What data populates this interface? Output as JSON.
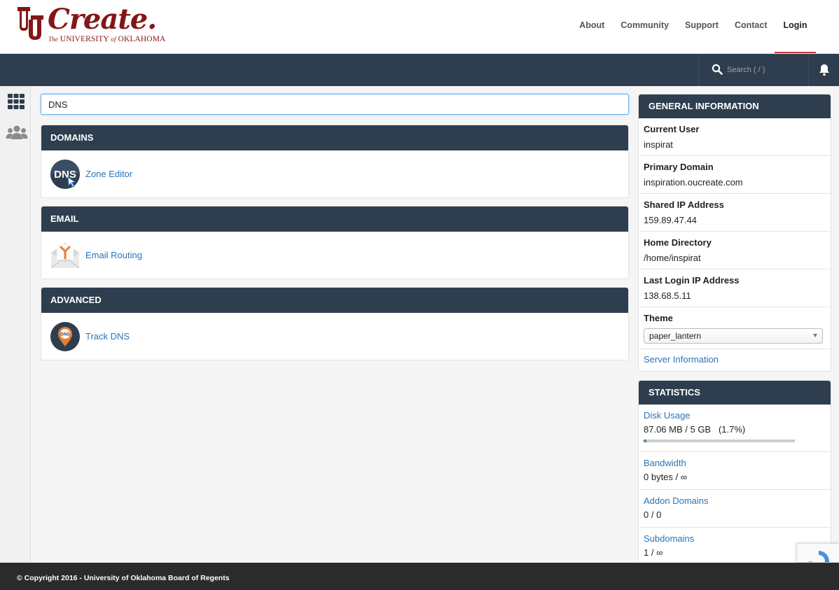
{
  "brand": {
    "logo_word": "Create.",
    "logo_sub_prefix": "The",
    "logo_sub_main": "UNIVERSITY",
    "logo_sub_of": "of",
    "logo_sub_end": "OKLAHOMA"
  },
  "nav": {
    "items": [
      {
        "label": "About"
      },
      {
        "label": "Community"
      },
      {
        "label": "Support"
      },
      {
        "label": "Contact"
      },
      {
        "label": "Login"
      }
    ]
  },
  "toolbar": {
    "search_placeholder": "Search ( / )"
  },
  "filter": {
    "value": "DNS"
  },
  "sections": [
    {
      "title": "DOMAINS",
      "item": "Zone Editor",
      "icon": "dns-zone-editor-icon",
      "icon_text": "DNS"
    },
    {
      "title": "EMAIL",
      "item": "Email Routing",
      "icon": "email-routing-icon"
    },
    {
      "title": "ADVANCED",
      "item": "Track DNS",
      "icon": "track-dns-icon",
      "icon_text": "DNS"
    }
  ],
  "general_info": {
    "title": "GENERAL INFORMATION",
    "rows": [
      {
        "label": "Current User",
        "value": "inspirat"
      },
      {
        "label": "Primary Domain",
        "value": "inspiration.oucreate.com"
      },
      {
        "label": "Shared IP Address",
        "value": "159.89.47.44"
      },
      {
        "label": "Home Directory",
        "value": "/home/inspirat"
      },
      {
        "label": "Last Login IP Address",
        "value": "138.68.5.11"
      }
    ],
    "theme_label": "Theme",
    "theme_value": "paper_lantern",
    "server_info_link": "Server Information"
  },
  "statistics": {
    "title": "STATISTICS",
    "disk_label": "Disk Usage",
    "disk_value": "87.06 MB / 5 GB   (1.7%)",
    "disk_fraction": 0.017,
    "bandwidth_label": "Bandwidth",
    "bandwidth_value": "0 bytes / ∞",
    "addon_label": "Addon Domains",
    "addon_value": "0 / 0",
    "subdomains_label": "Subdomains",
    "subdomains_value": "1 / ∞"
  },
  "footer": {
    "text": "© Copyright 2016 - University of Oklahoma Board of Regents"
  },
  "colors": {
    "brand_crimson": "#841617",
    "nav_dark": "#2e3e4f",
    "link_blue": "#2a74b9",
    "progress_green": "#46a546"
  }
}
